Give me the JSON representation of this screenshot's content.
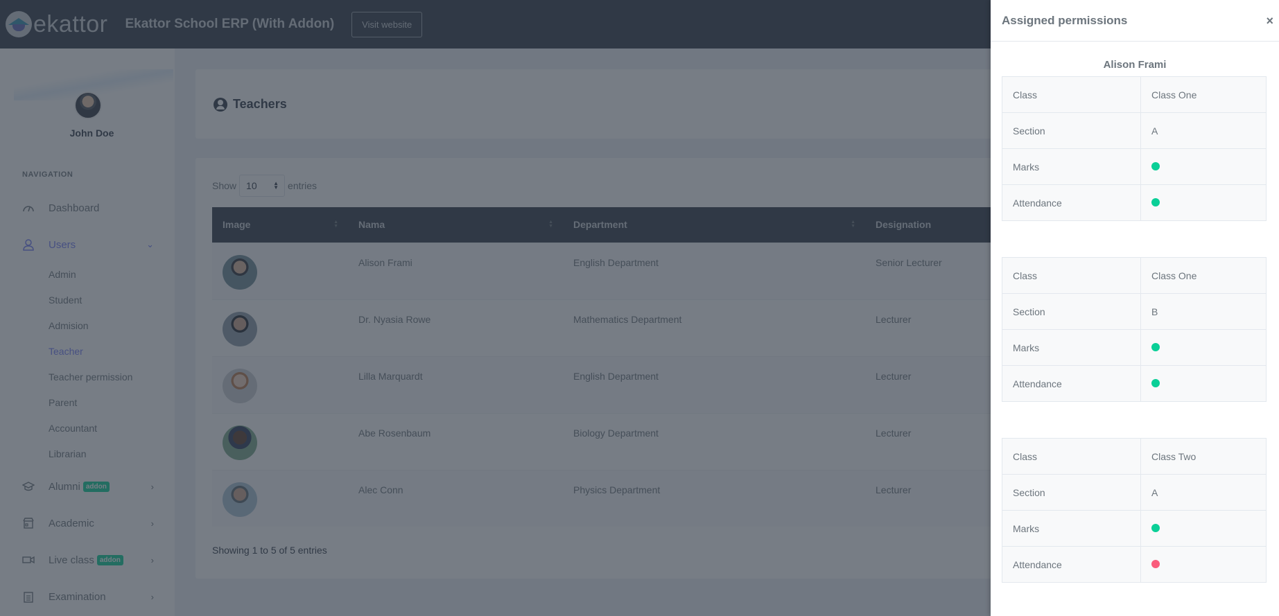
{
  "topbar": {
    "logo_text": "ekattor",
    "app_title": "Ekattor School ERP (With Addon)",
    "visit_button": "Visit website"
  },
  "sidebar": {
    "user_name": "John Doe",
    "nav_title": "NAVIGATION",
    "items": [
      {
        "label": "Dashboard",
        "icon": "dashboard-gauge-icon"
      },
      {
        "label": "Users",
        "icon": "user-icon",
        "active": true,
        "expanded": true
      },
      {
        "label": "Alumni",
        "icon": "graduation-cap-icon",
        "badge": "addon"
      },
      {
        "label": "Academic",
        "icon": "school-building-icon"
      },
      {
        "label": "Live class",
        "icon": "video-camera-icon",
        "badge": "addon"
      },
      {
        "label": "Examination",
        "icon": "clipboard-icon"
      }
    ],
    "users_sub": [
      "Admin",
      "Student",
      "Admision",
      "Teacher",
      "Teacher permission",
      "Parent",
      "Accountant",
      "Librarian"
    ],
    "active_sub": "Teacher"
  },
  "page": {
    "title": "Teachers",
    "show_label": "Show",
    "entries_value": "10",
    "entries_label": "entries",
    "columns": [
      "Image",
      "Nama",
      "Department",
      "Designation"
    ],
    "rows": [
      {
        "name": "Alison Frami",
        "department": "English Department",
        "designation": "Senior Lecturer"
      },
      {
        "name": "Dr. Nyasia Rowe",
        "department": "Mathematics Department",
        "designation": "Lecturer"
      },
      {
        "name": "Lilla Marquardt",
        "department": "English Department",
        "designation": "Lecturer"
      },
      {
        "name": "Abe Rosenbaum",
        "department": "Biology Department",
        "designation": "Lecturer"
      },
      {
        "name": "Alec Conn",
        "department": "Physics Department",
        "designation": "Lecturer"
      }
    ],
    "showing_text": "Showing 1 to 5 of 5 entries"
  },
  "drawer": {
    "title": "Assigned permissions",
    "close_label": "×",
    "teacher_name": "Alison Frami",
    "labels": {
      "class": "Class",
      "section": "Section",
      "marks": "Marks",
      "attendance": "Attendance"
    },
    "permissions": [
      {
        "class": "Class One",
        "section": "A",
        "marks": true,
        "attendance": true
      },
      {
        "class": "Class One",
        "section": "B",
        "marks": true,
        "attendance": true
      },
      {
        "class": "Class Two",
        "section": "A",
        "marks": true,
        "attendance": false
      }
    ]
  },
  "colors": {
    "granted": "#0acf97",
    "denied": "#fa5c7c",
    "accent": "#727cf5",
    "topbar": "#313a46"
  }
}
